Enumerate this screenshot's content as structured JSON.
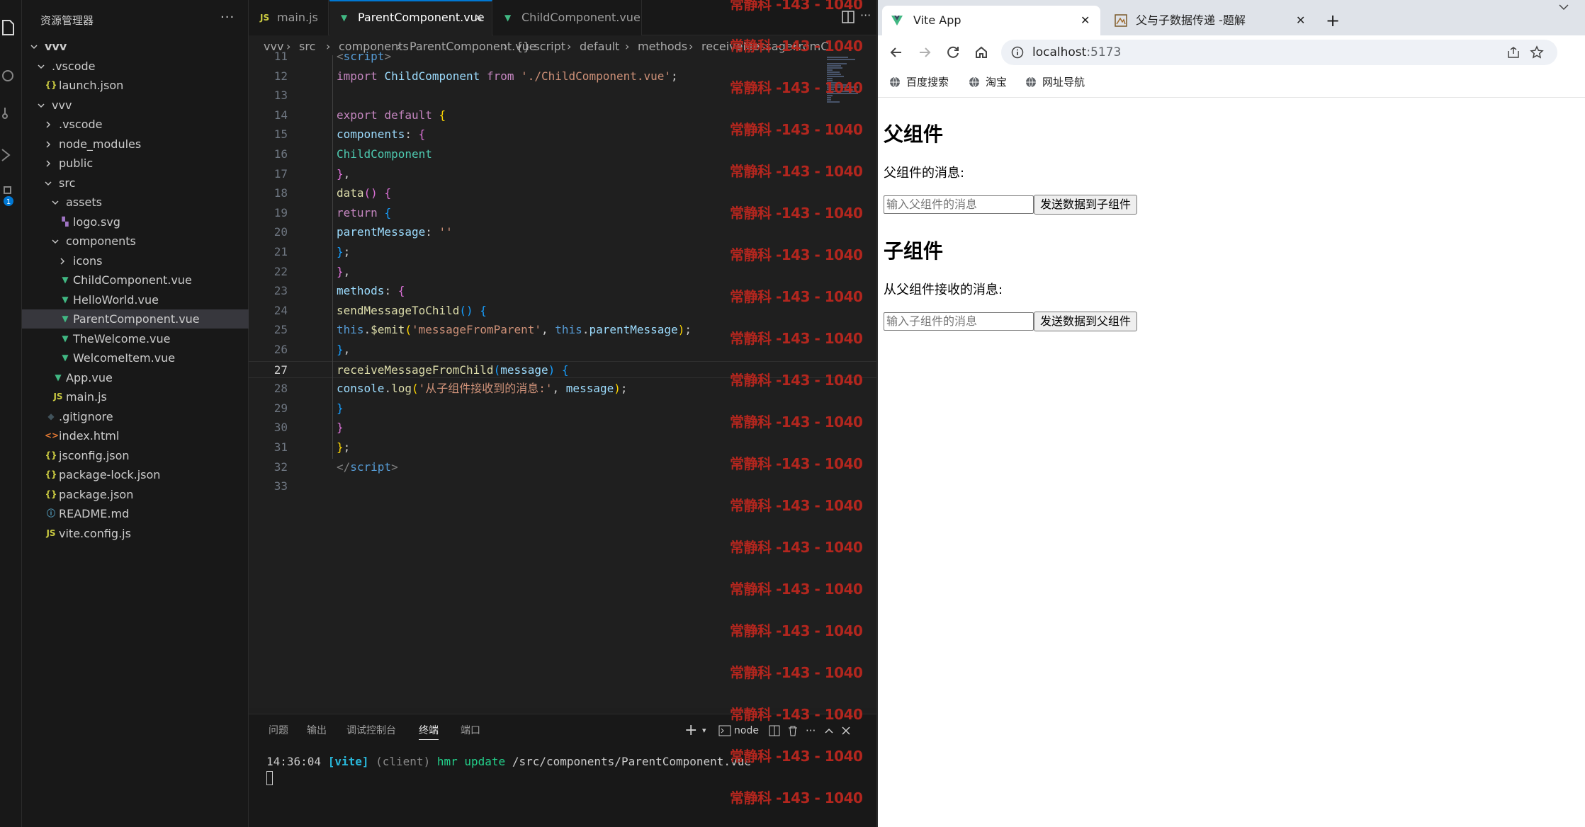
{
  "explorer": {
    "title": "资源管理器",
    "more": "···",
    "tree": [
      {
        "label": "vvv",
        "icon": "",
        "icon_color": "",
        "depth": 0,
        "folder": true,
        "open": true,
        "selected": false,
        "bold": true
      },
      {
        "label": ".vscode",
        "icon": "",
        "icon_color": "",
        "depth": 1,
        "folder": true,
        "open": true,
        "selected": false
      },
      {
        "label": "launch.json",
        "icon": "{}",
        "icon_color": "#cbcb41",
        "depth": 2,
        "folder": false,
        "selected": false
      },
      {
        "label": "vvv",
        "icon": "",
        "icon_color": "",
        "depth": 1,
        "folder": true,
        "open": true,
        "selected": false
      },
      {
        "label": ".vscode",
        "icon": "",
        "icon_color": "",
        "depth": 2,
        "folder": true,
        "open": false,
        "selected": false
      },
      {
        "label": "node_modules",
        "icon": "",
        "icon_color": "",
        "depth": 2,
        "folder": true,
        "open": false,
        "selected": false
      },
      {
        "label": "public",
        "icon": "",
        "icon_color": "",
        "depth": 2,
        "folder": true,
        "open": false,
        "selected": false
      },
      {
        "label": "src",
        "icon": "",
        "icon_color": "",
        "depth": 2,
        "folder": true,
        "open": true,
        "selected": false
      },
      {
        "label": "assets",
        "icon": "",
        "icon_color": "",
        "depth": 3,
        "folder": true,
        "open": true,
        "selected": false
      },
      {
        "label": "logo.svg",
        "icon": "▚",
        "icon_color": "#a074c4",
        "depth": 4,
        "folder": false,
        "selected": false
      },
      {
        "label": "components",
        "icon": "",
        "icon_color": "",
        "depth": 3,
        "folder": true,
        "open": true,
        "selected": false
      },
      {
        "label": "icons",
        "icon": "",
        "icon_color": "",
        "depth": 4,
        "folder": true,
        "open": false,
        "selected": false
      },
      {
        "label": "ChildComponent.vue",
        "icon": "▼",
        "icon_color": "#41b883",
        "depth": 4,
        "folder": false,
        "selected": false
      },
      {
        "label": "HelloWorld.vue",
        "icon": "▼",
        "icon_color": "#41b883",
        "depth": 4,
        "folder": false,
        "selected": false
      },
      {
        "label": "ParentComponent.vue",
        "icon": "▼",
        "icon_color": "#41b883",
        "depth": 4,
        "folder": false,
        "selected": true
      },
      {
        "label": "TheWelcome.vue",
        "icon": "▼",
        "icon_color": "#41b883",
        "depth": 4,
        "folder": false,
        "selected": false
      },
      {
        "label": "WelcomeItem.vue",
        "icon": "▼",
        "icon_color": "#41b883",
        "depth": 4,
        "folder": false,
        "selected": false
      },
      {
        "label": "App.vue",
        "icon": "▼",
        "icon_color": "#41b883",
        "depth": 3,
        "folder": false,
        "selected": false
      },
      {
        "label": "main.js",
        "icon": "JS",
        "icon_color": "#cbcb41",
        "depth": 3,
        "folder": false,
        "selected": false
      },
      {
        "label": ".gitignore",
        "icon": "◆",
        "icon_color": "#41535b",
        "depth": 2,
        "folder": false,
        "selected": false
      },
      {
        "label": "index.html",
        "icon": "<>",
        "icon_color": "#e37933",
        "depth": 2,
        "folder": false,
        "selected": false
      },
      {
        "label": "jsconfig.json",
        "icon": "{}",
        "icon_color": "#cbcb41",
        "depth": 2,
        "folder": false,
        "selected": false
      },
      {
        "label": "package-lock.json",
        "icon": "{}",
        "icon_color": "#cbcb41",
        "depth": 2,
        "folder": false,
        "selected": false
      },
      {
        "label": "package.json",
        "icon": "{}",
        "icon_color": "#cbcb41",
        "depth": 2,
        "folder": false,
        "selected": false
      },
      {
        "label": "README.md",
        "icon": "ⓘ",
        "icon_color": "#519aba",
        "depth": 2,
        "folder": false,
        "selected": false
      },
      {
        "label": "vite.config.js",
        "icon": "JS",
        "icon_color": "#cbcb41",
        "depth": 2,
        "folder": false,
        "selected": false
      }
    ]
  },
  "activity_badge": "1",
  "editor": {
    "tabs": [
      {
        "label": "main.js",
        "icon": "JS",
        "icon_color": "#cbcb41",
        "active": false
      },
      {
        "label": "ParentComponent.vue",
        "icon": "▼",
        "icon_color": "#41b883",
        "active": true,
        "close": "✕"
      },
      {
        "label": "ChildComponent.vue",
        "icon": "▼",
        "icon_color": "#41b883",
        "active": false
      }
    ],
    "breadcrumbs": [
      "vvv",
      "›",
      "src",
      "›",
      "components",
      "›",
      "ParentComponent.vue",
      "›",
      "{} script",
      "›",
      "default",
      "›",
      "methods",
      "›",
      "receiveMessageFromC"
    ],
    "lines": [
      {
        "n": "11",
        "html": "<span class=\"g\">&lt;</span><span class=\"b\">script</span><span class=\"g\">&gt;</span>"
      },
      {
        "n": "12",
        "html": "<span class=\"k\">import</span> <span class=\"p\">ChildComponent</span> <span class=\"k\">from</span> <span class=\"s\">'./ChildComponent.vue'</span>;"
      },
      {
        "n": "13",
        "html": ""
      },
      {
        "n": "14",
        "html": "<span class=\"k\">export</span> <span class=\"k\">default</span> <span class=\"y\">{</span>"
      },
      {
        "n": "15",
        "html": "<span class=\"p\">components</span>: <span class=\"pk\">{</span>"
      },
      {
        "n": "16",
        "html": "<span class=\"t\">ChildComponent</span>"
      },
      {
        "n": "17",
        "html": "<span class=\"pk\">}</span>,"
      },
      {
        "n": "18",
        "html": "<span class=\"f\">data</span><span class=\"pk\">()</span> <span class=\"pk\">{</span>"
      },
      {
        "n": "19",
        "html": "<span class=\"k\">return</span> <span class=\"br\">{</span>"
      },
      {
        "n": "20",
        "html": "<span class=\"p\">parentMessage</span>: <span class=\"s\">''</span>"
      },
      {
        "n": "21",
        "html": "<span class=\"br\">}</span>;"
      },
      {
        "n": "22",
        "html": "<span class=\"pk\">}</span>,"
      },
      {
        "n": "23",
        "html": "<span class=\"p\">methods</span>: <span class=\"pk\">{</span>"
      },
      {
        "n": "24",
        "html": "<span class=\"f\">sendMessageToChild</span><span class=\"br\">()</span> <span class=\"br\">{</span>"
      },
      {
        "n": "25",
        "html": "<span class=\"b\">this</span>.<span class=\"f\">$emit</span><span class=\"y\">(</span><span class=\"s\">'messageFromParent'</span>, <span class=\"b\">this</span>.<span class=\"p\">parentMessage</span><span class=\"y\">)</span>;"
      },
      {
        "n": "26",
        "html": "<span class=\"br\">}</span>,"
      },
      {
        "n": "27",
        "html": "<span class=\"f\">receiveMessageFromChild</span><span class=\"br\">(</span><span class=\"p\">message</span><span class=\"br\">)</span> <span class=\"br\">{</span>"
      },
      {
        "n": "28",
        "html": "<span class=\"p\">console</span>.<span class=\"f\">log</span><span class=\"y\">(</span><span class=\"s\">'从子组件接收到的消息:'</span>, <span class=\"p\">message</span><span class=\"y\">)</span>;"
      },
      {
        "n": "29",
        "html": "<span class=\"br\">}</span>"
      },
      {
        "n": "30",
        "html": "<span class=\"pk\">}</span>"
      },
      {
        "n": "31",
        "html": "<span class=\"y\">}</span>;"
      },
      {
        "n": "32",
        "html": "<span class=\"g\">&lt;/</span><span class=\"b\">script</span><span class=\"g\">&gt;</span>"
      },
      {
        "n": "33",
        "html": ""
      }
    ],
    "current_line": "27"
  },
  "panel": {
    "tabs": [
      "问题",
      "输出",
      "调试控制台",
      "终端",
      "端口"
    ],
    "active_tab": "终端",
    "plus": "+",
    "shell": "node",
    "terminal_line": {
      "time": "14:36:04",
      "tag": "[vite]",
      "client": "(client)",
      "action": "hmr update",
      "path": "/src/components/ParentComponent.vue"
    }
  },
  "watermark": "常静科 -143 - 1040",
  "browser": {
    "tabs": [
      {
        "title": "Vite App",
        "active": true
      },
      {
        "title": "父与子数据传递 -题解",
        "active": false
      }
    ],
    "url_host": "localhost",
    "url_port": ":5173",
    "bookmarks": [
      "百度搜索",
      "淘宝",
      "网址导航"
    ],
    "page": {
      "parent_heading": "父组件",
      "parent_label": "父组件的消息:",
      "parent_placeholder": "输入父组件的消息",
      "parent_button": "发送数据到子组件",
      "child_heading": "子组件",
      "child_label": "从父组件接收的消息:",
      "child_placeholder": "输入子组件的消息",
      "child_button": "发送数据到父组件"
    }
  }
}
